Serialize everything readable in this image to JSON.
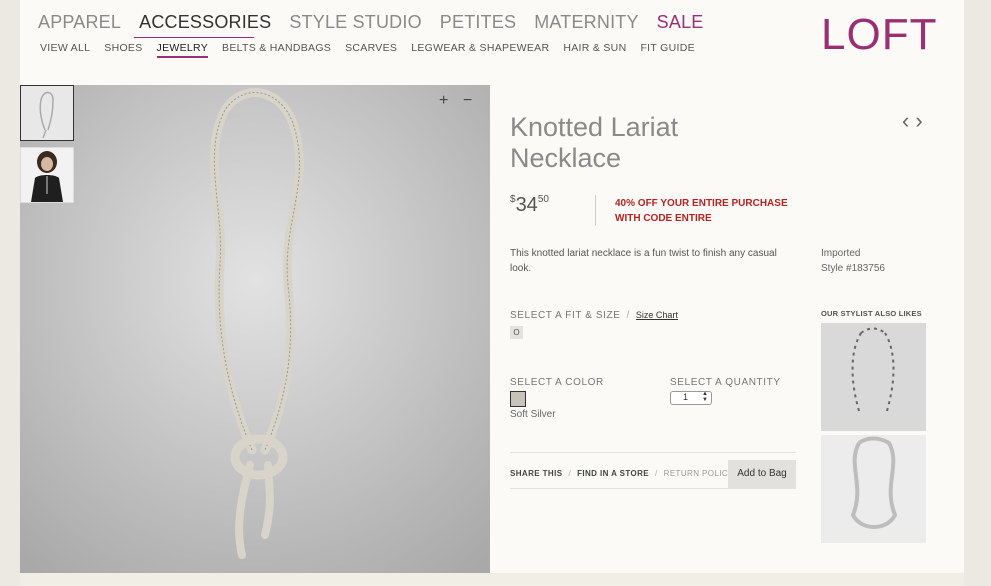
{
  "nav": {
    "main": [
      "APPAREL",
      "ACCESSORIES",
      "STYLE STUDIO",
      "PETITES",
      "MATERNITY",
      "SALE"
    ],
    "sub": [
      "VIEW ALL",
      "SHOES",
      "JEWELRY",
      "BELTS & HANDBAGS",
      "SCARVES",
      "LEGWEAR & SHAPEWEAR",
      "HAIR & SUN",
      "FIT GUIDE"
    ],
    "logo": "LOFT"
  },
  "image": {
    "zoom_in": "+",
    "zoom_out": "−"
  },
  "product": {
    "title": "Knotted Lariat Necklace",
    "price_currency": "$",
    "price_dollars": "34",
    "price_cents": "50",
    "promo": "40% OFF YOUR ENTIRE PURCHASE WITH CODE ENTIRE",
    "description": "This knotted lariat necklace is a fun twist to finish any casual look.",
    "origin": "Imported",
    "style": "Style #183756",
    "nav_prev": "‹",
    "nav_next": "›"
  },
  "options": {
    "fit_label": "SELECT A FIT & SIZE",
    "fit_sep": "/",
    "size_chart": "Size Chart",
    "size_value": "O",
    "color_label": "SELECT A COLOR",
    "color_name": "Soft Silver",
    "color_hex": "#c6c3bb",
    "qty_label": "SELECT A QUANTITY",
    "qty_value": "1"
  },
  "actions": {
    "share": "SHARE THIS",
    "find": "FIND IN A STORE",
    "return": "RETURN POLICY",
    "add_to_bag": "Add to Bag"
  },
  "stylist": {
    "label": "OUR STYLIST ALSO LIKES"
  },
  "colors": {
    "brand": "#9a2f73",
    "promo": "#b52323"
  }
}
